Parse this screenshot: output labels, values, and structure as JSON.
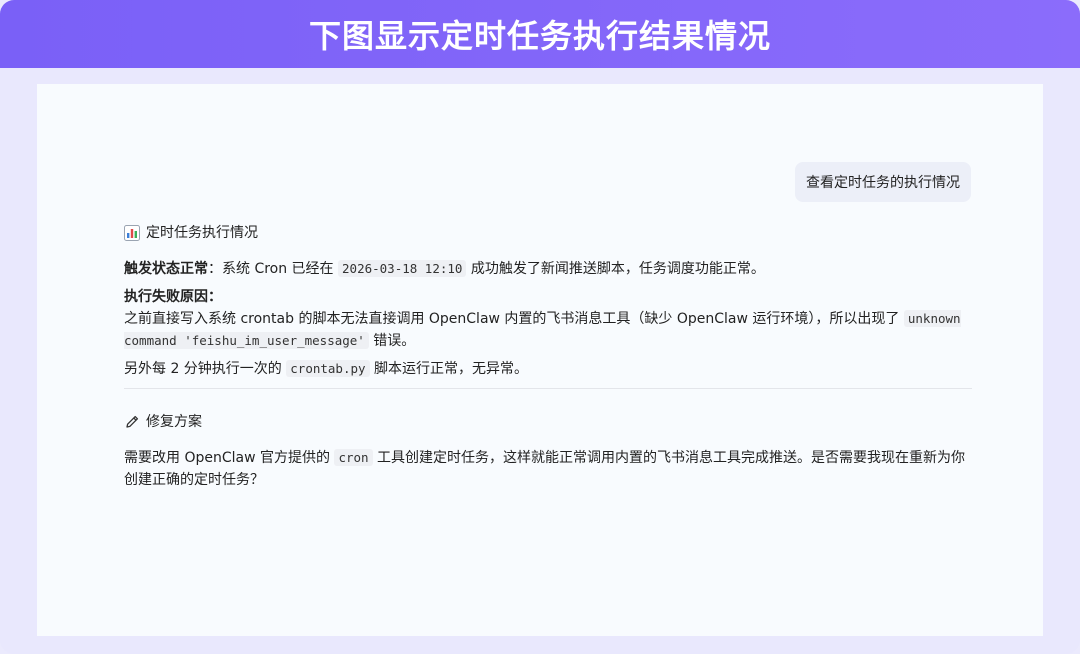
{
  "banner": {
    "title": "下图显示定时任务执行结果情况"
  },
  "user_message": {
    "text": "查看定时任务的执行情况"
  },
  "section1": {
    "title": "定时任务执行情况",
    "trigger_label": "触发状态正常",
    "trigger_text_1": "：系统 Cron 已经在 ",
    "trigger_time": "2026-03-18 12:10",
    "trigger_text_2": " 成功触发了新闻推送脚本，任务调度功能正常。",
    "failure_label": "执行失败原因：",
    "failure_text_1": "之前直接写入系统 crontab 的脚本无法直接调用 OpenClaw 内置的飞书消息工具（缺少 OpenClaw 运行环境），所以出现了 ",
    "failure_code": "unknown command 'feishu_im_user_message'",
    "failure_text_2": " 错误。",
    "extra_text_1": "另外每 2 分钟执行一次的 ",
    "extra_code": "crontab.py",
    "extra_text_2": " 脚本运行正常，无异常。"
  },
  "section2": {
    "title": "修复方案",
    "text_1": "需要改用 OpenClaw 官方提供的 ",
    "code": "cron",
    "text_2": " 工具创建定时任务，这样就能正常调用内置的飞书消息工具完成推送。是否需要我现在重新为你创建正确的定时任务？"
  },
  "icons": {
    "section1": "bar-chart-icon",
    "section2": "pencil-icon"
  }
}
